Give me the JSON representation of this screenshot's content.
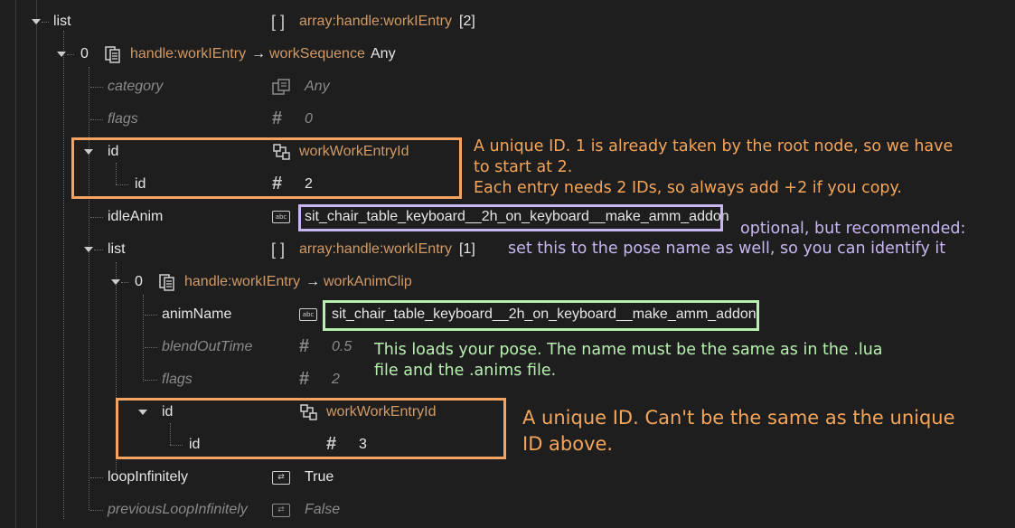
{
  "tree": {
    "root": {
      "key": "list",
      "type_bracket": "[ ]",
      "type": "array:handle:workIEntry",
      "count": "[2]"
    },
    "entry0": {
      "index": "0",
      "handle": "handle:workIEntry",
      "arrow": "→",
      "cls": "workSequence",
      "cls_val": "Any"
    },
    "category": {
      "key": "category",
      "value": "Any"
    },
    "flags": {
      "key": "flags",
      "value": "0"
    },
    "id_outer": {
      "key": "id",
      "type": "workWorkEntryId"
    },
    "id_inner": {
      "key": "id",
      "value": "2"
    },
    "idleAnim": {
      "key": "idleAnim",
      "value": "sit_chair_table_keyboard__2h_on_keyboard__make_amm_addon"
    },
    "list2": {
      "key": "list",
      "type_bracket": "[ ]",
      "type": "array:handle:workIEntry",
      "count": "[1]"
    },
    "entry00": {
      "index": "0",
      "handle": "handle:workIEntry",
      "arrow": "→",
      "cls": "workAnimClip"
    },
    "animName": {
      "key": "animName",
      "value": "sit_chair_table_keyboard__2h_on_keyboard__make_amm_addon"
    },
    "blendOutTime": {
      "key": "blendOutTime",
      "value": "0.5"
    },
    "flags2": {
      "key": "flags",
      "value": "2"
    },
    "id2_outer": {
      "key": "id",
      "type": "workWorkEntryId"
    },
    "id2_inner": {
      "key": "id",
      "value": "3"
    },
    "loopInfinitely": {
      "key": "loopInfinitely",
      "value": "True"
    },
    "previousLoopInfinitely": {
      "key": "previousLoopInfinitely",
      "value": "False"
    }
  },
  "icons": {
    "abc": "abc",
    "bool": "⇄",
    "hash": "#",
    "id_type": "id-type-icon",
    "handle": "handle-icon",
    "enum": "enum-icon"
  },
  "annotations": {
    "note1_line1": "A unique ID. 1 is already taken by the root node, so we have",
    "note1_line2": "to start at 2.",
    "note1_line3": "Each entry needs 2 IDs, so always add +2 if you copy.",
    "note2_line1": "optional, but recommended:",
    "note2_line2": "set this to the pose name as well, so you can identify it",
    "note3_line1": "This loads your pose. The name must be the same as in the .lua",
    "note3_line2": "file and the .anims file.",
    "note4_line1": "A unique ID. Can't be the same as the unique",
    "note4_line2": "ID above."
  },
  "colors": {
    "background": "#1e1e1e",
    "orange_box": "#f4a460",
    "lavender_box": "#c8b6f0",
    "green_box": "#b8f0b0",
    "orange_text": "#f5a55a",
    "lavender_text": "#c8b6f0",
    "green_text": "#b8f0b0",
    "type_orange": "#d19a66"
  }
}
